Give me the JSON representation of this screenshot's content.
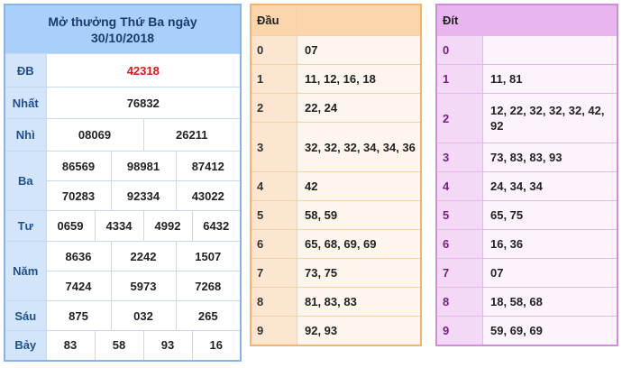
{
  "results": {
    "title_line1": "Mở thưởng Thứ Ba ngày",
    "title_line2": "30/10/2018",
    "special": {
      "label": "ĐB",
      "values": [
        "42318"
      ]
    },
    "first": {
      "label": "Nhất",
      "values": [
        "76832"
      ]
    },
    "second": {
      "label": "Nhì",
      "values": [
        "08069",
        "26211"
      ]
    },
    "third": {
      "label": "Ba",
      "values": [
        "86569",
        "98981",
        "87412",
        "70283",
        "92334",
        "43022"
      ]
    },
    "fourth": {
      "label": "Tư",
      "values": [
        "0659",
        "4334",
        "4992",
        "6432"
      ]
    },
    "fifth": {
      "label": "Năm",
      "values": [
        "8636",
        "2242",
        "1507",
        "7424",
        "5973",
        "7268"
      ]
    },
    "sixth": {
      "label": "Sáu",
      "values": [
        "875",
        "032",
        "265"
      ]
    },
    "seventh": {
      "label": "Bảy",
      "values": [
        "83",
        "58",
        "93",
        "16"
      ]
    }
  },
  "dau": {
    "header": "Đầu",
    "rows": [
      {
        "key": "0",
        "values": "07"
      },
      {
        "key": "1",
        "values": "11, 12, 16, 18"
      },
      {
        "key": "2",
        "values": "22, 24"
      },
      {
        "key": "3",
        "values": "32, 32, 32, 34, 34, 36"
      },
      {
        "key": "4",
        "values": "42"
      },
      {
        "key": "5",
        "values": "58, 59"
      },
      {
        "key": "6",
        "values": "65, 68, 69, 69"
      },
      {
        "key": "7",
        "values": "73, 75"
      },
      {
        "key": "8",
        "values": "81, 83, 83"
      },
      {
        "key": "9",
        "values": "92, 93"
      }
    ]
  },
  "dit": {
    "header": "Đít",
    "rows": [
      {
        "key": "0",
        "values": ""
      },
      {
        "key": "1",
        "values": "11, 81"
      },
      {
        "key": "2",
        "values": "12, 22, 32, 32, 32, 42, 92"
      },
      {
        "key": "3",
        "values": "73, 83, 83, 93"
      },
      {
        "key": "4",
        "values": "24, 34, 34"
      },
      {
        "key": "5",
        "values": "65, 75"
      },
      {
        "key": "6",
        "values": "16, 36"
      },
      {
        "key": "7",
        "values": "07"
      },
      {
        "key": "8",
        "values": "18, 58, 68"
      },
      {
        "key": "9",
        "values": "59, 69, 69"
      }
    ]
  },
  "colors": {
    "results_header": "#a8d0fa",
    "results_label": "#d2e5fb",
    "special_prize": "#e01515",
    "dau_header": "#fbd6ad",
    "dit_header": "#e8b5ef",
    "dit_number": "#7a1f85"
  }
}
